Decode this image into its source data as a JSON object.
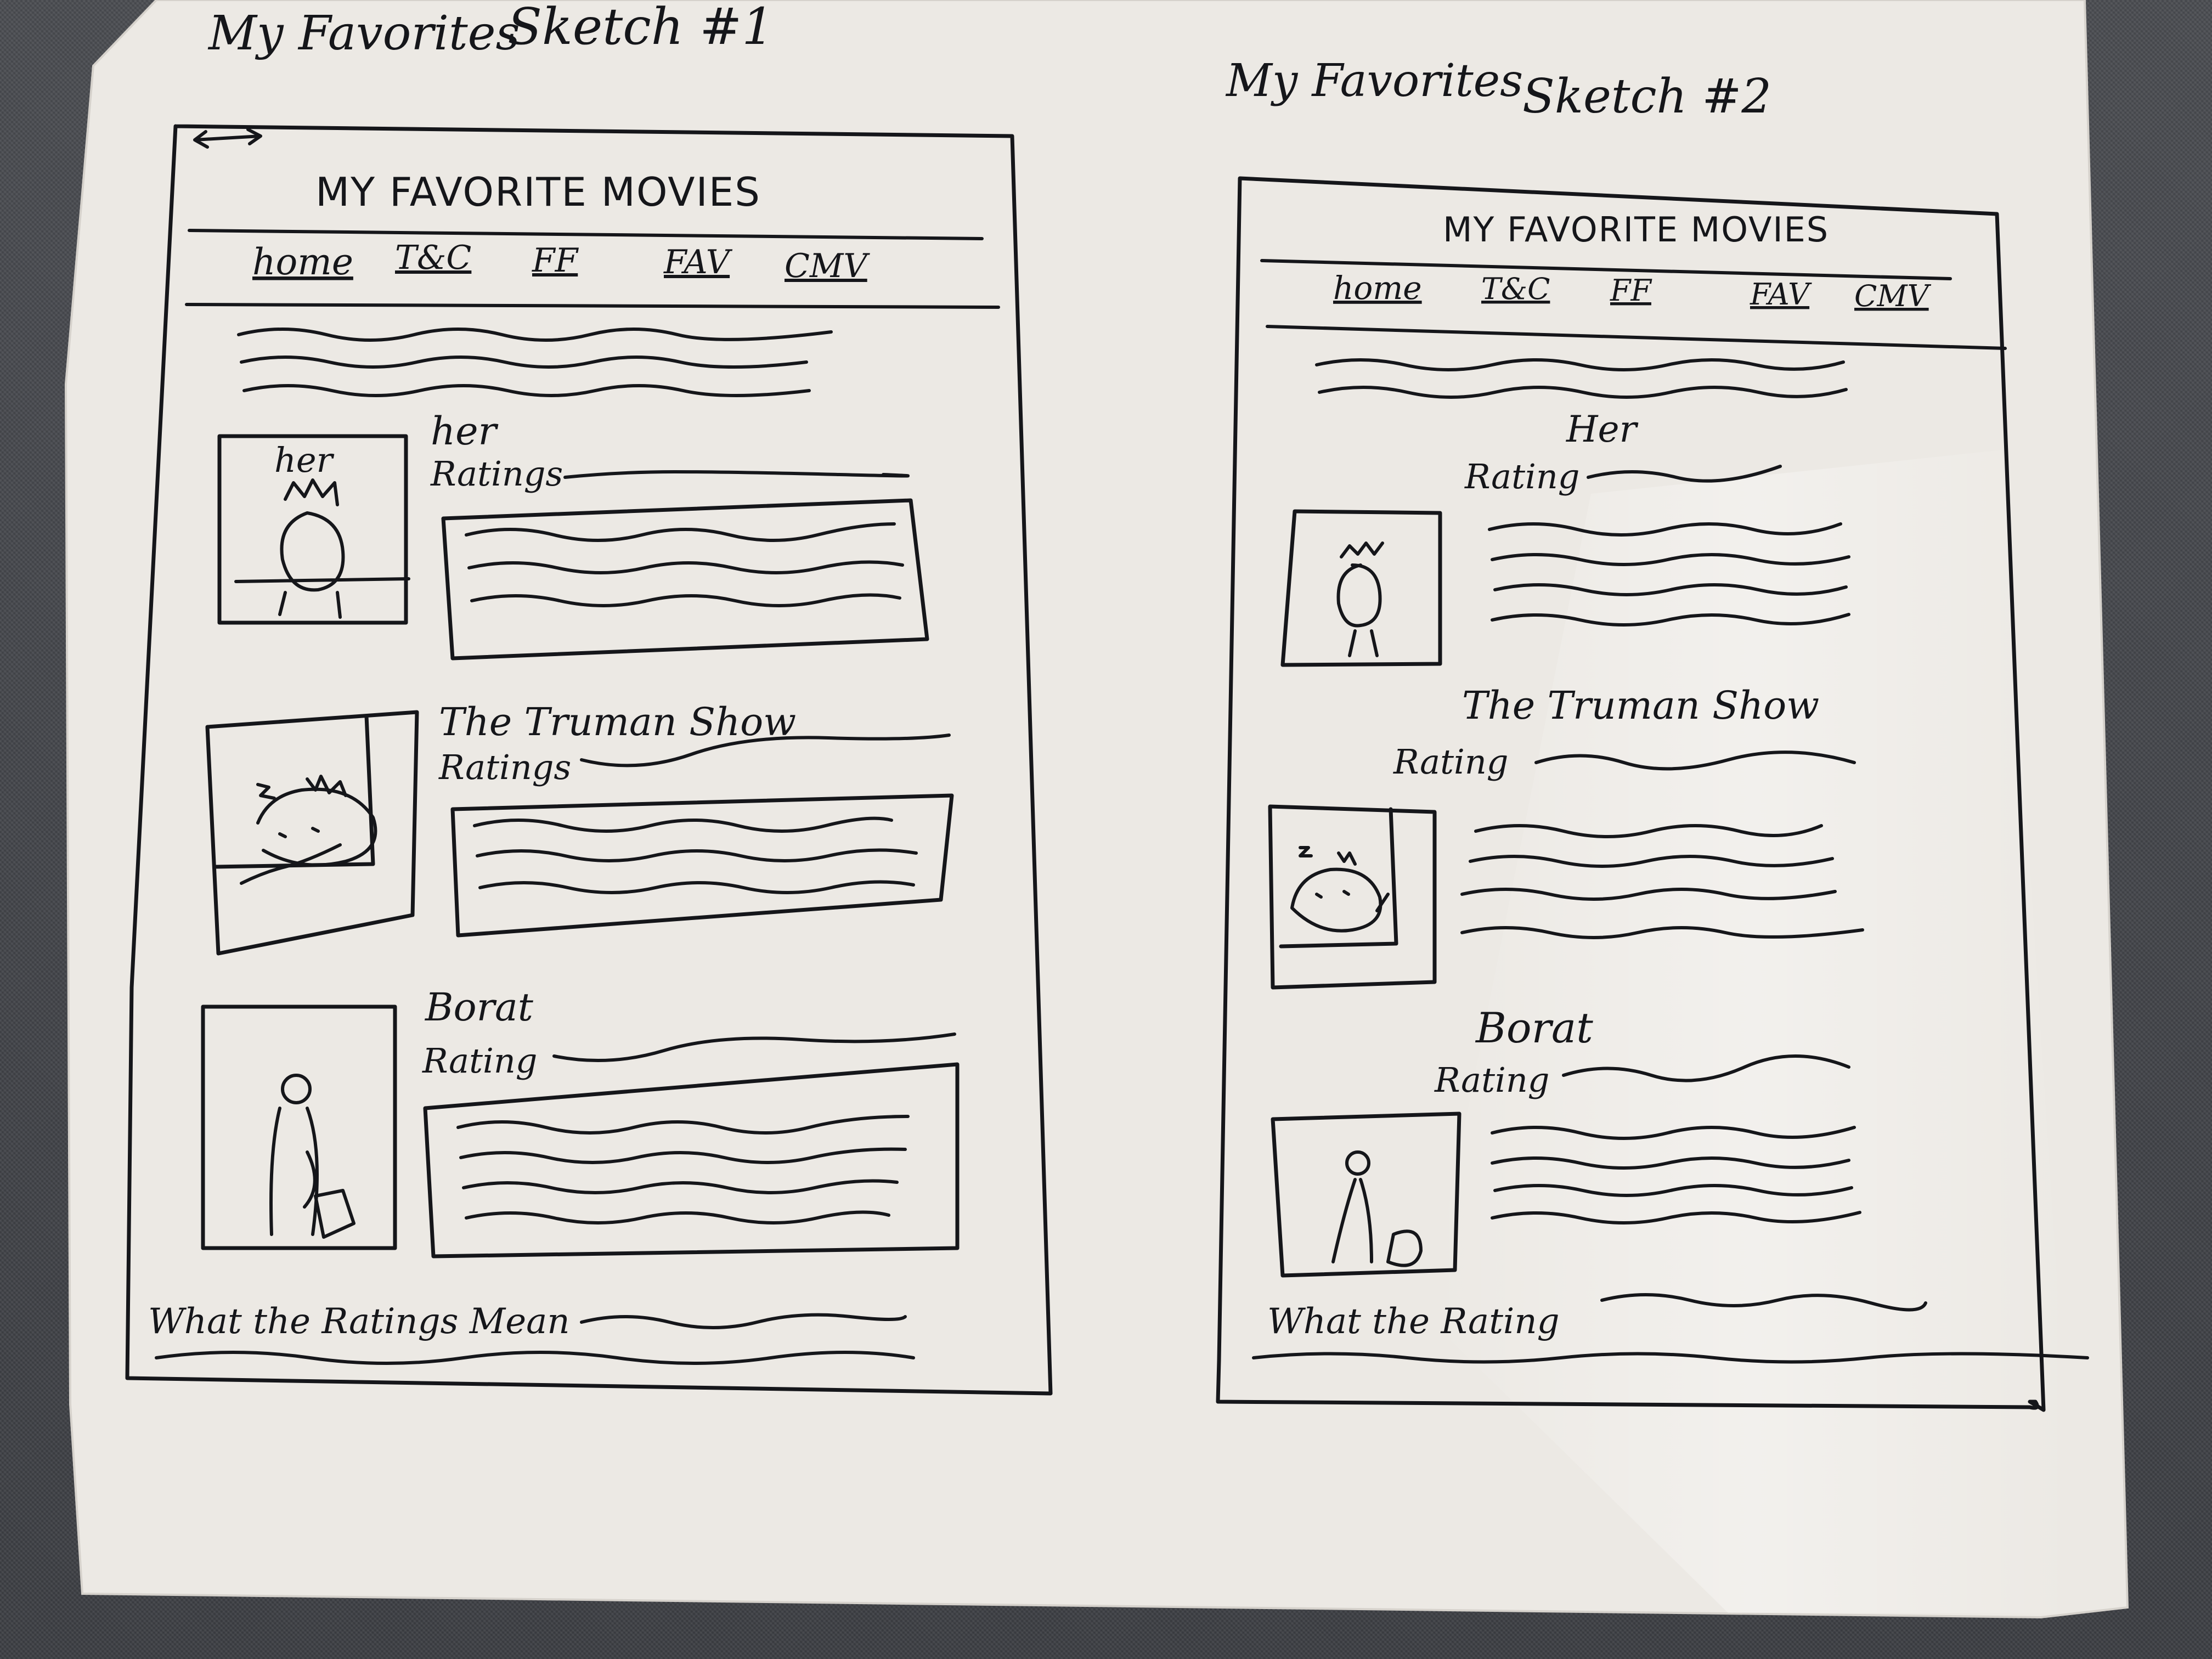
{
  "paper_color": "#ece9e4",
  "ink_color": "#15161a",
  "sketch1": {
    "heading": "My Favorites",
    "sketch_label": "Sketch #1",
    "page_title": "MY FAVORITE MOVIES",
    "nav": [
      "home",
      "T&C",
      "FF",
      "FAV",
      "CMV"
    ],
    "movies": [
      {
        "title": "her",
        "poster_text": "her",
        "rating_label": "Ratings"
      },
      {
        "title": "The Truman Show",
        "rating_label": "Ratings"
      },
      {
        "title": "Borat",
        "rating_label": "Rating"
      }
    ],
    "footer": "What the Ratings Mean"
  },
  "sketch2": {
    "heading": "My Favorites",
    "sketch_label": "Sketch #2",
    "page_title": "MY FAVORITE MOVIES",
    "nav": [
      "home",
      "T&C",
      "FF",
      "FAV",
      "CMV"
    ],
    "movies": [
      {
        "title": "Her",
        "rating_label": "Rating"
      },
      {
        "title": "The Truman Show",
        "rating_label": "Rating"
      },
      {
        "title": "Borat",
        "rating_label": "Rating"
      }
    ],
    "footer": "What the Rating"
  }
}
